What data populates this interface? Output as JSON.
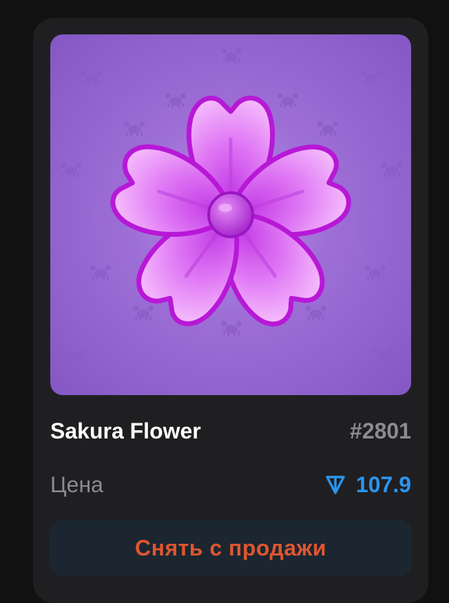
{
  "card": {
    "title": "Sakura Flower",
    "number": "#2801",
    "price_label": "Цена",
    "price_value": "107.9",
    "currency_icon": "ton-diamond-icon",
    "action_label": "Снять с продажи"
  },
  "colors": {
    "background": "#111111",
    "card": "#1f1f21",
    "title": "#ffffff",
    "muted": "#8b8b90",
    "price": "#2b95ec",
    "button_bg": "#1b2630",
    "button_text": "#e0552f",
    "media_bg": "#9d6fd6",
    "petal": "#d65ff0"
  },
  "media": {
    "subject_icon": "sakura-flower-icon",
    "pattern_icon": "crab-icon"
  }
}
